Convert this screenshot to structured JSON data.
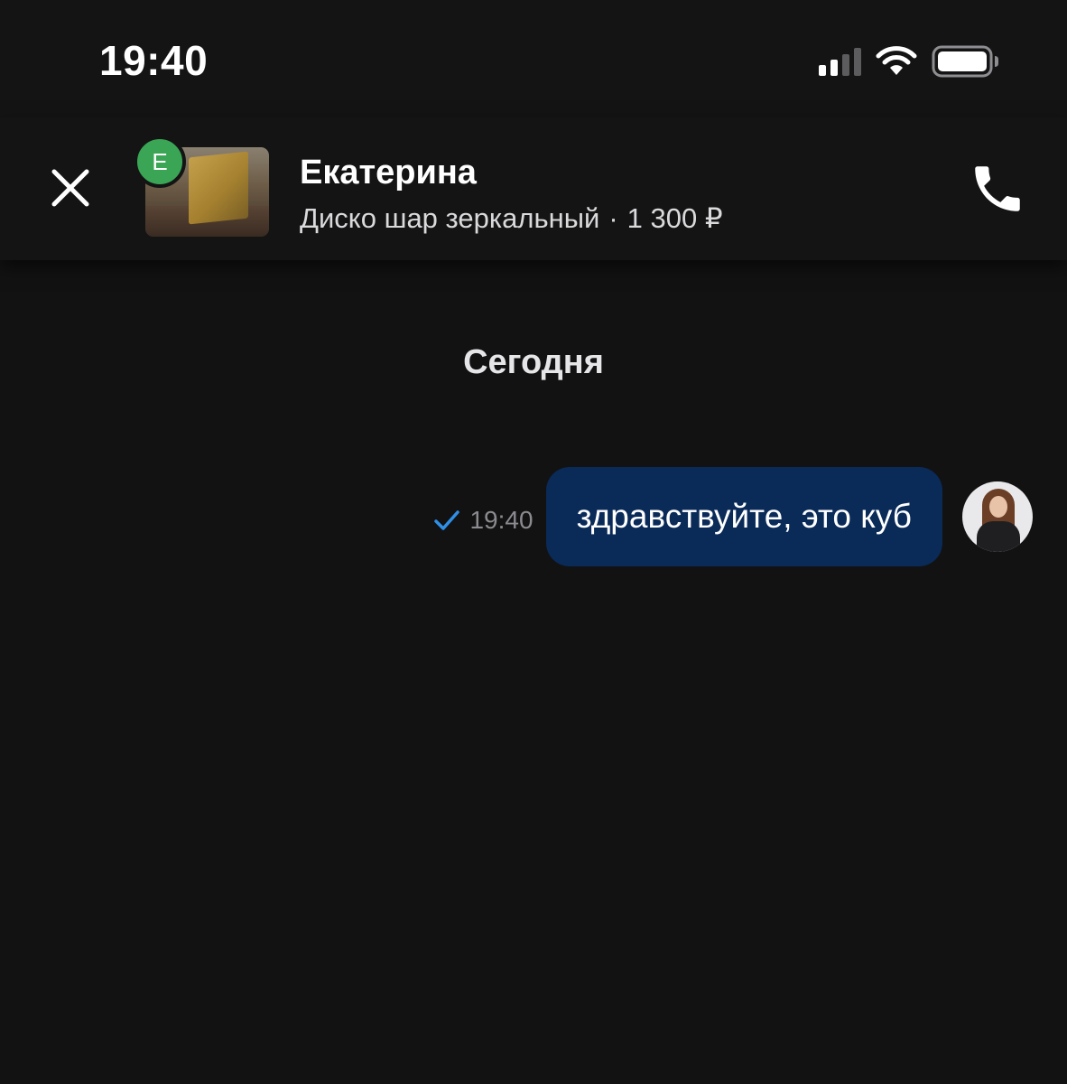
{
  "status_bar": {
    "time": "19:40",
    "icons": [
      "cellular-signal-icon",
      "wifi-icon",
      "battery-icon"
    ]
  },
  "header": {
    "contact_name": "Екатерина",
    "contact_initial": "Е",
    "item_title": "Диско шар зеркальный",
    "separator": "·",
    "item_price": "1 300 ₽",
    "close_icon": "close-icon",
    "call_icon": "phone-icon"
  },
  "conversation": {
    "date_label": "Сегодня",
    "messages": [
      {
        "text": "здравствуйте, это куб",
        "time": "19:40",
        "status": "sent",
        "status_icon": "checkmark-icon",
        "direction": "outgoing"
      }
    ]
  },
  "colors": {
    "background": "#121213",
    "header_background": "#141415",
    "bubble_outgoing": "#0a2a58",
    "online_badge": "#3aa655",
    "check_mark": "#2f8fe6",
    "secondary_text": "#8b8b8f"
  }
}
